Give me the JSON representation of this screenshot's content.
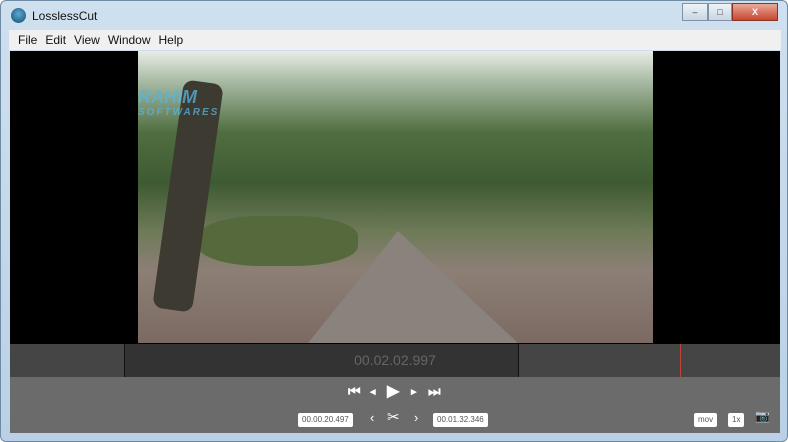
{
  "window": {
    "title": "LosslessCut",
    "minimize": "‒",
    "maximize": "□",
    "close": "X"
  },
  "menu": [
    "File",
    "Edit",
    "View",
    "Window",
    "Help"
  ],
  "watermark": {
    "line1": "RAHIM",
    "line2": "SOFTWARES"
  },
  "timeline": {
    "current_time": "00.02.02.997",
    "playhead_fraction": 0.87
  },
  "playback": {
    "first": "⏮",
    "prev": "◂",
    "play": "▶",
    "next": "▸",
    "last": "⏭"
  },
  "cut": {
    "start": "00.00.20.497",
    "end": "00.01.32.346",
    "prev": "‹",
    "scissors": "✂",
    "next": "›"
  },
  "options": {
    "format": "mov",
    "speed": "1x",
    "snapshot": "📷"
  }
}
